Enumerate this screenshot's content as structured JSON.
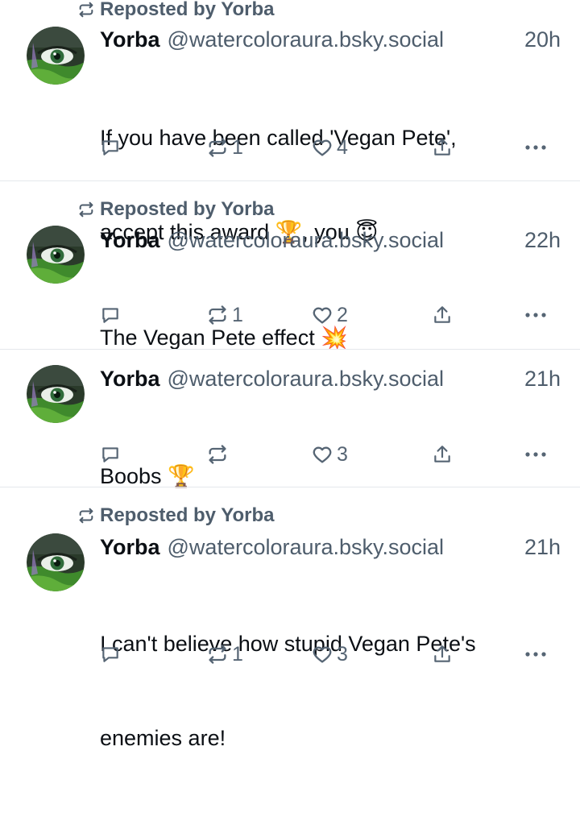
{
  "colors": {
    "text": "#0b0f14",
    "muted": "#4e5d6c",
    "icon": "#566574",
    "divider": "#e4e8ec",
    "avatar_green": "#3f8a2c"
  },
  "posts": [
    {
      "repost_label": "Reposted by Yorba",
      "author_name": "Yorba",
      "author_handle": "@watercoloraura.bsky.social",
      "time": "20h",
      "text_lines": [
        "If you have been called 'Vegan Pete',",
        "accept this award 🏆, you 😇"
      ],
      "reply_count": "",
      "repost_count": "1",
      "like_count": "4"
    },
    {
      "repost_label": "Reposted by Yorba",
      "author_name": "Yorba",
      "author_handle": "@watercoloraura.bsky.social",
      "time": "22h",
      "text_lines": [
        "The Vegan Pete effect 💥"
      ],
      "reply_count": "",
      "repost_count": "1",
      "like_count": "2"
    },
    {
      "repost_label": "",
      "author_name": "Yorba",
      "author_handle": "@watercoloraura.bsky.social",
      "time": "21h",
      "text_lines": [
        "Boobs 🏆"
      ],
      "reply_count": "",
      "repost_count": "",
      "like_count": "3"
    },
    {
      "repost_label": "Reposted by Yorba",
      "author_name": "Yorba",
      "author_handle": "@watercoloraura.bsky.social",
      "time": "21h",
      "text_lines": [
        "I can't believe how stupid Vegan Pete's",
        "enemies are!"
      ],
      "reply_count": "",
      "repost_count": "1",
      "like_count": "3"
    }
  ]
}
